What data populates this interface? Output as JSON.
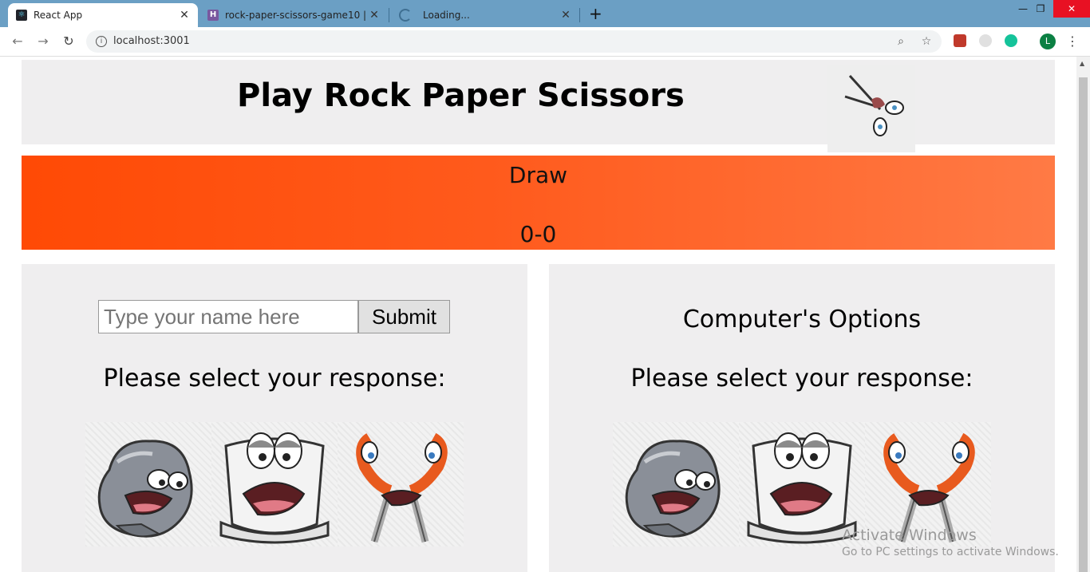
{
  "browser": {
    "tabs": [
      {
        "title": "React App",
        "close": "✕"
      },
      {
        "title": "rock-paper-scissors-game10 | He",
        "close": "✕"
      },
      {
        "title": "Loading...",
        "close": "✕"
      }
    ],
    "new_tab": "+",
    "url": "localhost:3001",
    "profile_initial": "L"
  },
  "header": {
    "title": "Play Rock Paper Scissors"
  },
  "status": {
    "result": "Draw",
    "score": "0-0",
    "colors": {
      "start": "#ff4a05",
      "end": "#ff7a45"
    }
  },
  "player_panel": {
    "name_placeholder": "Type your name here",
    "submit_label": "Submit",
    "prompt": "Please select your response:",
    "choices": [
      "rock",
      "paper",
      "scissors"
    ]
  },
  "computer_panel": {
    "heading": "Computer's Options",
    "prompt": "Please select your response:",
    "choices": [
      "rock",
      "paper",
      "scissors"
    ]
  },
  "watermark": {
    "line1": "Activate Windows",
    "line2": "Go to PC settings to activate Windows."
  }
}
